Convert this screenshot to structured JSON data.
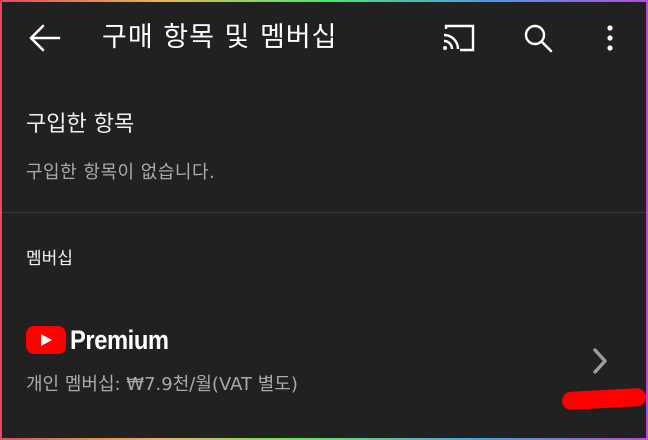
{
  "header": {
    "title": "구매 항목 및 멤버십",
    "back_icon": "arrow-back-icon",
    "cast_icon": "cast-icon",
    "search_icon": "search-icon",
    "more_icon": "more-vertical-icon"
  },
  "purchases": {
    "title": "구입한 항목",
    "empty_text": "구입한 항목이 없습니다."
  },
  "membership": {
    "heading": "멤버십",
    "brand": "Premium",
    "plan": "개인 멤버십: ₩7.9천/월(VAT 별도)",
    "chevron_icon": "chevron-right-icon"
  },
  "colors": {
    "background": "#212121",
    "youtube_red": "#ff0000",
    "secondary_text": "#aaaaaa",
    "annotation_red": "#ff0000"
  }
}
